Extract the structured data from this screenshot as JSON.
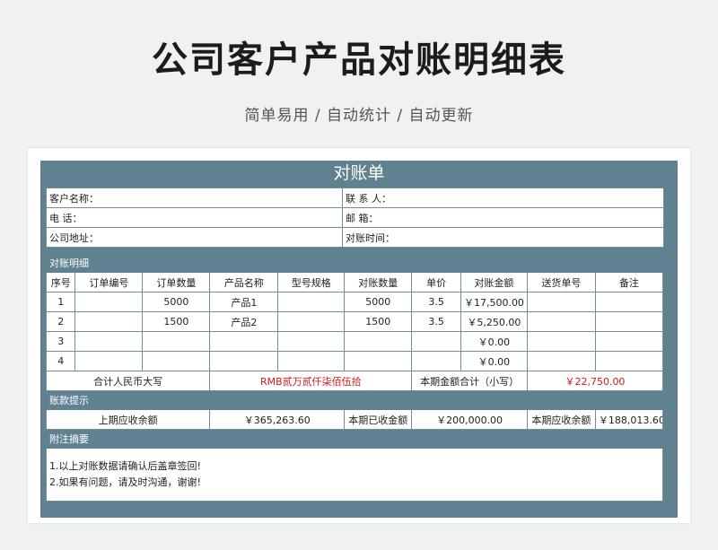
{
  "header": {
    "title": "公司客户产品对账明细表",
    "subtitle": "简单易用 / 自动统计 / 自动更新"
  },
  "doc": {
    "title": "对账单",
    "info": {
      "customer_name": "客户名称：",
      "contact": "联  系  人：",
      "phone": "电      话：",
      "email": "邮      箱：",
      "address": "公司地址：",
      "statement_time": "对账时间："
    },
    "detail_section": "对账明细",
    "columns": [
      "序号",
      "订单编号",
      "订单数量",
      "产品名称",
      "型号规格",
      "对账数量",
      "单价",
      "对账金额",
      "送货单号",
      "备注"
    ],
    "rows": [
      {
        "no": "1",
        "order_no": "",
        "order_qty": "5000",
        "product": "产品1",
        "spec": "",
        "qty": "5000",
        "price": "3.5",
        "amount": "￥17,500.00",
        "delivery_no": "",
        "remark": ""
      },
      {
        "no": "2",
        "order_no": "",
        "order_qty": "1500",
        "product": "产品2",
        "spec": "",
        "qty": "1500",
        "price": "3.5",
        "amount": "￥5,250.00",
        "delivery_no": "",
        "remark": ""
      },
      {
        "no": "3",
        "order_no": "",
        "order_qty": "",
        "product": "",
        "spec": "",
        "qty": "",
        "price": "",
        "amount": "￥0.00",
        "delivery_no": "",
        "remark": ""
      },
      {
        "no": "4",
        "order_no": "",
        "order_qty": "",
        "product": "",
        "spec": "",
        "qty": "",
        "price": "",
        "amount": "￥0.00",
        "delivery_no": "",
        "remark": ""
      }
    ],
    "total": {
      "rmb_label": "合计人民币大写",
      "rmb_value": "RMB贰万贰仟柒佰伍拾",
      "sum_label": "本期金额合计（小写）",
      "sum_value": "￥22,750.00"
    },
    "payment_section": "账款提示",
    "payment": {
      "prev_label": "上期应收余额",
      "prev_value": "￥365,263.60",
      "received_label": "本期已收金额",
      "received_value": "￥200,000.00",
      "due_label": "本期应收余额",
      "due_value": "￥188,013.60"
    },
    "notes_section": "附注摘要",
    "notes": [
      "1.以上对账数据请确认后盖章签回!",
      "2.如果有问题，请及时沟通，谢谢!"
    ],
    "colors": {
      "band": "#5f8190",
      "amount_red": "#d01818"
    }
  }
}
